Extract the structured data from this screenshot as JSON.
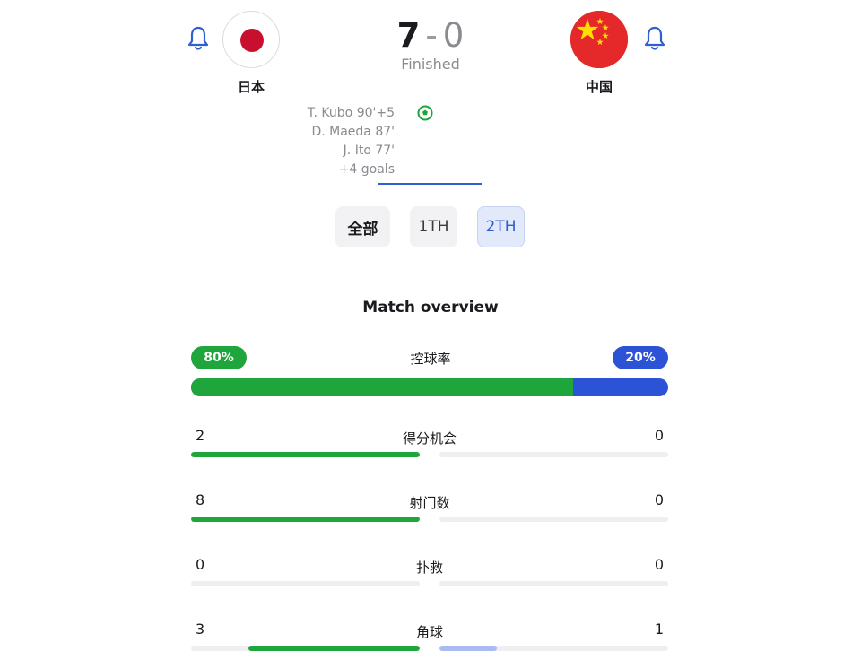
{
  "match": {
    "home": {
      "name": "日本",
      "score": "7",
      "notify_icon": "bell-icon",
      "flag": "japan-flag"
    },
    "away": {
      "name": "中国",
      "score": "0",
      "notify_icon": "bell-icon",
      "flag": "china-flag"
    },
    "separator": "-",
    "status": "Finished",
    "scorers": [
      "T. Kubo 90'+5",
      "D. Maeda 87'",
      "J. Ito 77'",
      "+4 goals"
    ],
    "scorers_icon": "soccer-ball-icon"
  },
  "period_tabs": [
    {
      "label": "全部",
      "selected": false
    },
    {
      "label": "1TH",
      "selected": false
    },
    {
      "label": "2TH",
      "selected": true
    }
  ],
  "overview": {
    "title": "Match overview",
    "possession": {
      "label": "控球率",
      "home": "80%",
      "away": "20%",
      "home_fraction": 0.8
    },
    "stats": [
      {
        "label": "得分机会",
        "home": "2",
        "away": "0",
        "home_fraction": 1.0,
        "away_fraction": 0.0
      },
      {
        "label": "射门数",
        "home": "8",
        "away": "0",
        "home_fraction": 1.0,
        "away_fraction": 0.0
      },
      {
        "label": "扑救",
        "home": "0",
        "away": "0",
        "home_fraction": 0.0,
        "away_fraction": 0.0
      },
      {
        "label": "角球",
        "home": "3",
        "away": "1",
        "home_fraction": 0.75,
        "away_fraction": 0.25
      }
    ]
  },
  "colors": {
    "home": "#1ea63c",
    "away": "#2c52d6",
    "away_light": "#a9bbf0",
    "accent": "#2f5fd1"
  }
}
